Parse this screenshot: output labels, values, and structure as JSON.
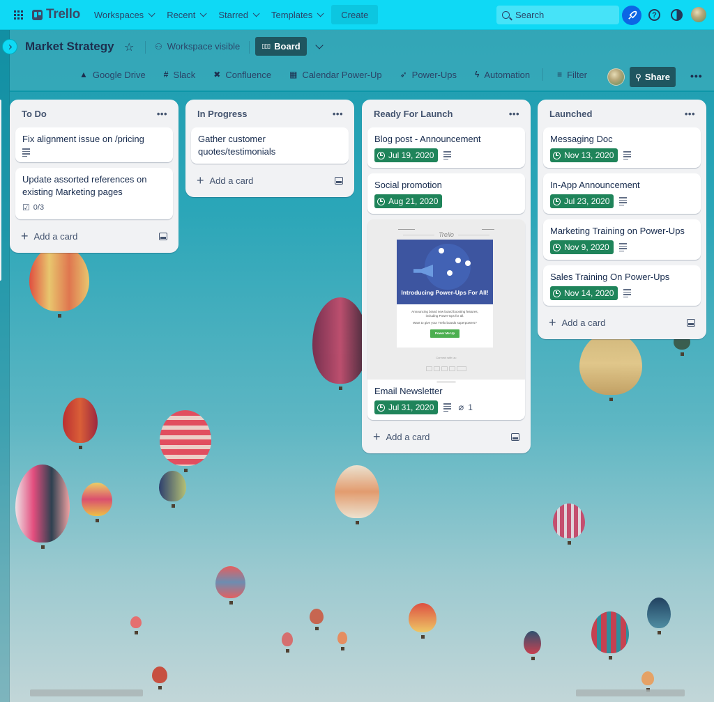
{
  "topnav": {
    "logo": "Trello",
    "menus": [
      {
        "label": "Workspaces"
      },
      {
        "label": "Recent"
      },
      {
        "label": "Starred"
      },
      {
        "label": "Templates"
      }
    ],
    "create_label": "Create",
    "search_placeholder": "Search",
    "icons": [
      "apps-grid-icon",
      "rocket-icon",
      "help-icon",
      "theme-icon",
      "avatar"
    ]
  },
  "board": {
    "title": "Market Strategy",
    "visibility": "Workspace visible",
    "view_label": "Board",
    "powerups": [
      {
        "label": "Google Drive",
        "icon": "google-drive-icon"
      },
      {
        "label": "Slack",
        "icon": "slack-icon"
      },
      {
        "label": "Confluence",
        "icon": "confluence-icon"
      },
      {
        "label": "Calendar Power-Up",
        "icon": "calendar-icon"
      },
      {
        "label": "Power-Ups",
        "icon": "rocket-icon"
      },
      {
        "label": "Automation",
        "icon": "lightning-icon"
      }
    ],
    "filter_label": "Filter",
    "share_label": "Share"
  },
  "lists": [
    {
      "title": "To Do",
      "cards": [
        {
          "title": "Fix alignment issue on /pricing",
          "description": true
        },
        {
          "title": "Update assorted references on existing Marketing pages",
          "checklist": "0/3"
        }
      ],
      "add_label": "Add a card"
    },
    {
      "title": "In Progress",
      "cards": [
        {
          "title": "Gather customer quotes/testimonials"
        }
      ],
      "add_label": "Add a card"
    },
    {
      "title": "Ready For Launch",
      "cards": [
        {
          "title": "Blog post - Announcement",
          "due": "Jul 19, 2020",
          "description": true
        },
        {
          "title": "Social promotion",
          "due": "Aug 21, 2020"
        },
        {
          "title": "Email Newsletter",
          "due": "Jul 31, 2020",
          "description": true,
          "attachments": "1",
          "cover": {
            "logo": "Trello",
            "headline": "Introducing Power-Ups For All!",
            "body1": "Announcing brand new board boosting features, including Power-Ups for all.",
            "body2": "Want to give your Trello boards superpowers?",
            "cta": "Power Me Up",
            "connect": "Connect with us:"
          }
        }
      ],
      "add_label": "Add a card"
    },
    {
      "title": "Launched",
      "cards": [
        {
          "title": "Messaging Doc",
          "due": "Nov 13, 2020",
          "description": true
        },
        {
          "title": "In-App Announcement",
          "due": "Jul 23, 2020",
          "description": true
        },
        {
          "title": "Marketing Training on Power-Ups",
          "due": "Nov 9, 2020",
          "description": true
        },
        {
          "title": "Sales Training On Power-Ups",
          "due": "Nov 14, 2020",
          "description": true
        }
      ],
      "add_label": "Add a card"
    }
  ],
  "colors": {
    "topnav_bg": "#0fd9f5",
    "due_badge": "#1f845a",
    "share_btn": "#1f5660",
    "list_bg": "#f1f2f4"
  }
}
